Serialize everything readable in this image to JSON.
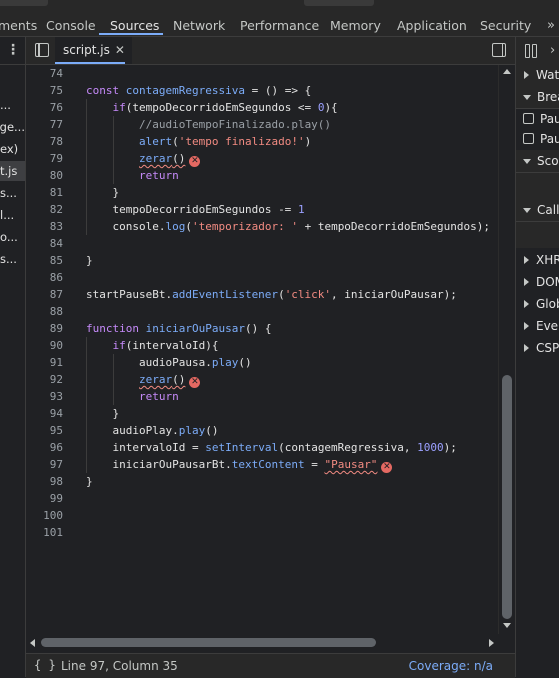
{
  "devtools_tabs": [
    {
      "label": "ments",
      "active": false
    },
    {
      "label": "Console",
      "active": false
    },
    {
      "label": "Sources",
      "active": true
    },
    {
      "label": "Network",
      "active": false
    },
    {
      "label": "Performance",
      "active": false
    },
    {
      "label": "Memory",
      "active": false
    },
    {
      "label": "Application",
      "active": false
    },
    {
      "label": "Security",
      "active": false
    }
  ],
  "overflow_icon": "»",
  "navigator": {
    "kebab_icon": "⋮",
    "items": [
      {
        "label": "...",
        "selected": false
      },
      {
        "label": "ge...",
        "selected": false
      },
      {
        "label": "ex)",
        "selected": false
      },
      {
        "label": "t.js",
        "selected": true
      },
      {
        "label": "s...",
        "selected": false
      },
      {
        "label": "l...",
        "selected": false
      },
      {
        "label": "o...",
        "selected": false
      },
      {
        "label": "s...",
        "selected": false
      }
    ]
  },
  "editor": {
    "file_tab": "script.js",
    "close_icon": "✕"
  },
  "code_lines": [
    {
      "n": "74",
      "indent": 0,
      "html": ""
    },
    {
      "n": "75",
      "indent": 0,
      "html": "<span class='kw'>const</span> <span class='fn'>contagemRegressiva</span> = () => {"
    },
    {
      "n": "76",
      "indent": 1,
      "html": "<span class='kw'>if</span>(tempoDecorridoEmSegundos <= <span class='num'>0</span>){"
    },
    {
      "n": "77",
      "indent": 2,
      "html": "<span class='cm'>//audioTempoFinalizado.play()</span>"
    },
    {
      "n": "78",
      "indent": 2,
      "html": "<span class='fn'>alert</span>(<span class='str'>'tempo finalizado!'</span>)"
    },
    {
      "n": "79",
      "indent": 2,
      "html": "<span class='err-squig'><span class='fn'>zerar</span>()</span><span class='err-icon'>✕</span>"
    },
    {
      "n": "80",
      "indent": 2,
      "html": "<span class='kw'>return</span>"
    },
    {
      "n": "81",
      "indent": 1,
      "html": "}"
    },
    {
      "n": "82",
      "indent": 1,
      "html": "tempoDecorridoEmSegundos -= <span class='num'>1</span>"
    },
    {
      "n": "83",
      "indent": 1,
      "html": "console.<span class='fn'>log</span>(<span class='str'>'temporizador: '</span> + tempoDecorridoEmSegundos);"
    },
    {
      "n": "84",
      "indent": 0,
      "html": ""
    },
    {
      "n": "85",
      "indent": 0,
      "html": "}"
    },
    {
      "n": "86",
      "indent": 0,
      "html": ""
    },
    {
      "n": "87",
      "indent": 0,
      "html": "startPauseBt.<span class='fn'>addEventListener</span>(<span class='str'>'click'</span>, iniciarOuPausar);"
    },
    {
      "n": "88",
      "indent": 0,
      "html": ""
    },
    {
      "n": "89",
      "indent": 0,
      "html": "<span class='kw'>function</span> <span class='fn'>iniciarOuPausar</span>() {"
    },
    {
      "n": "90",
      "indent": 1,
      "html": "<span class='kw'>if</span>(intervaloId){"
    },
    {
      "n": "91",
      "indent": 2,
      "html": "audioPausa.<span class='fn'>play</span>()"
    },
    {
      "n": "92",
      "indent": 2,
      "html": "<span class='err-squig'><span class='fn'>zerar</span>()</span><span class='err-icon'>✕</span>"
    },
    {
      "n": "93",
      "indent": 2,
      "html": "<span class='kw'>return</span>"
    },
    {
      "n": "94",
      "indent": 1,
      "html": "}"
    },
    {
      "n": "95",
      "indent": 1,
      "html": "audioPlay.<span class='fn'>play</span>()"
    },
    {
      "n": "96",
      "indent": 1,
      "html": "intervaloId = <span class='fn'>setInterval</span>(contagemRegressiva, <span class='num'>1000</span>);"
    },
    {
      "n": "97",
      "indent": 1,
      "html": "iniciarOuPausarBt.<span class='prop'>textContent</span> = <span class='err-squig'><span class='str'>\"Pausar\"</span></span><span class='err-icon'>✕</span>"
    },
    {
      "n": "98",
      "indent": 0,
      "html": "}"
    },
    {
      "n": "99",
      "indent": 0,
      "html": ""
    },
    {
      "n": "100",
      "indent": 0,
      "html": ""
    },
    {
      "n": "101",
      "indent": 0,
      "html": ""
    }
  ],
  "status": {
    "braces_icon": "{ }",
    "position": "Line 97, Column 35",
    "coverage": "Coverage: n/a"
  },
  "sidebar": {
    "watch": "Watc",
    "breakpoints": "Brea",
    "pause_uncaught": "Paus",
    "pause_caught": "Paus",
    "scope": "Scop",
    "call_stack": "Call",
    "xhr": "XHR",
    "dom": "DOM",
    "global": "Glob",
    "event": "Even",
    "csp": "CSP"
  }
}
